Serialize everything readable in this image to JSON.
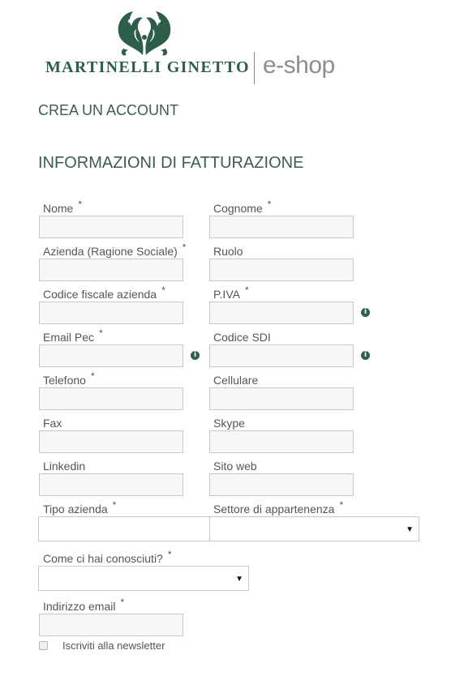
{
  "header": {
    "brand_name": "MARTINELLI GINETTO",
    "shop_label": "e-shop"
  },
  "page": {
    "title": "CREA UN ACCOUNT",
    "section_title": "INFORMAZIONI DI FATTURAZIONE"
  },
  "form": {
    "required_marker": "*",
    "fields": {
      "nome": "Nome",
      "cognome": "Cognome",
      "azienda": "Azienda (Ragione Sociale)",
      "ruolo": "Ruolo",
      "codice_fiscale": "Codice fiscale azienda",
      "piva": "P.IVA",
      "email_pec": "Email Pec",
      "codice_sdi": "Codice SDI",
      "telefono": "Telefono",
      "cellulare": "Cellulare",
      "fax": "Fax",
      "skype": "Skype",
      "linkedin": "Linkedin",
      "sito_web": "Sito web",
      "tipo_azienda": "Tipo azienda",
      "settore": "Settore di appartenenza",
      "come_conosciuti": "Come ci hai conosciuti?",
      "indirizzo_email": "Indirizzo email"
    },
    "newsletter_label": "Iscriviti alla newsletter",
    "info_glyph": "i",
    "select_caret": "▼"
  },
  "colors": {
    "brand_green": "#2d5e4a",
    "heading_color": "#3d5c55",
    "input_bg": "#f7f7f7",
    "input_border": "#c8c8c8"
  }
}
